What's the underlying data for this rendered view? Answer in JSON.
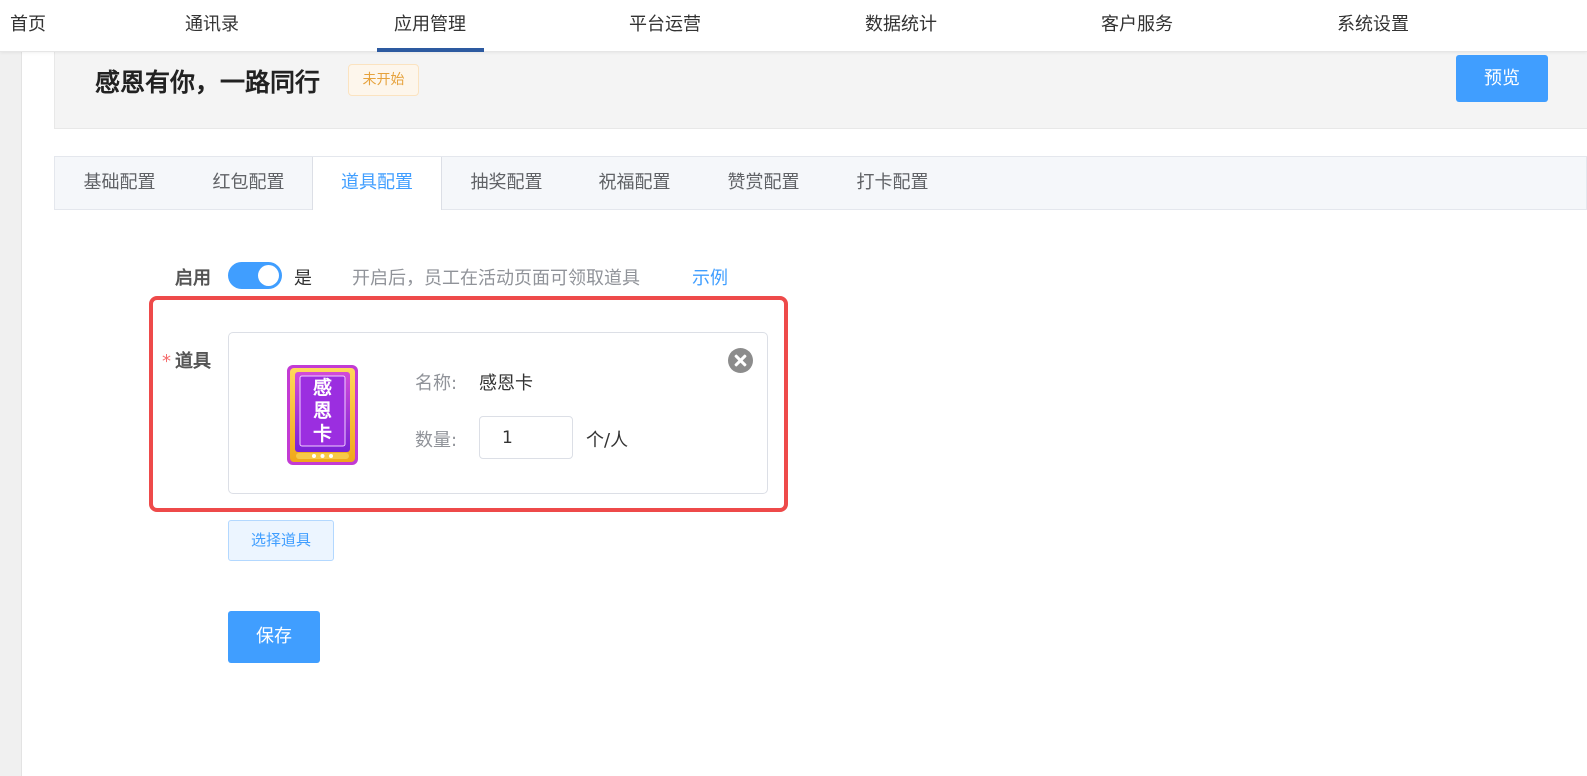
{
  "nav": {
    "items": [
      {
        "label": "首页"
      },
      {
        "label": "通讯录"
      },
      {
        "label": "应用管理"
      },
      {
        "label": "平台运营"
      },
      {
        "label": "数据统计"
      },
      {
        "label": "客户服务"
      },
      {
        "label": "系统设置"
      }
    ],
    "active": "应用管理"
  },
  "header": {
    "title": "感恩有你，一路同行",
    "status": "未开始",
    "preview_label": "预览"
  },
  "tabs": {
    "items": [
      {
        "label": "基础配置"
      },
      {
        "label": "红包配置"
      },
      {
        "label": "道具配置"
      },
      {
        "label": "抽奖配置"
      },
      {
        "label": "祝福配置"
      },
      {
        "label": "赞赏配置"
      },
      {
        "label": "打卡配置"
      }
    ],
    "active": "道具配置"
  },
  "form": {
    "enable": {
      "label": "启用",
      "value": "是",
      "on": true,
      "hint": "开启后，员工在活动页面可领取道具",
      "example_link": "示例"
    },
    "prop": {
      "required_mark": "*",
      "label": "道具",
      "name_label": "名称:",
      "name_value": "感恩卡",
      "quantity_label": "数量:",
      "quantity_value": "1",
      "unit": "个/人",
      "image_text": [
        "感",
        "恩",
        "卡"
      ],
      "image_icon": "thanks-card-icon"
    },
    "select_label": "选择道具",
    "save_label": "保存"
  },
  "colors": {
    "primary": "#409eff",
    "highlight_frame": "#ee4a4a",
    "status_badge": "#e6a23c",
    "nav_underline": "#2d5aa0",
    "card_purple": "#8e2de2",
    "card_gold": "#f7c948"
  }
}
